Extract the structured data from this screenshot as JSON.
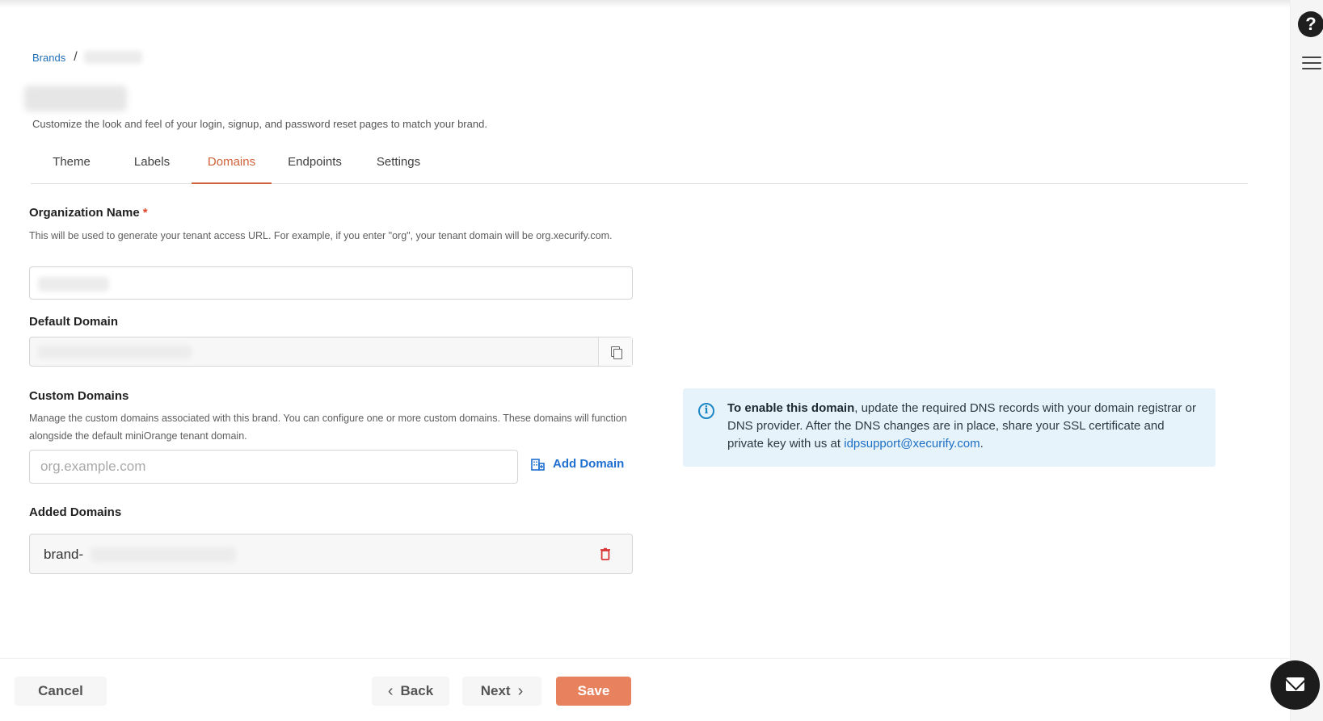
{
  "breadcrumb": {
    "root": "Brands",
    "separator": "/"
  },
  "page": {
    "subtitle": "Customize the look and feel of your login, signup, and password reset pages to match your brand."
  },
  "tabs": [
    {
      "label": "Theme"
    },
    {
      "label": "Labels"
    },
    {
      "label": "Domains",
      "active": true
    },
    {
      "label": "Endpoints"
    },
    {
      "label": "Settings"
    }
  ],
  "org_name": {
    "label": "Organization Name",
    "required_mark": "*",
    "help": "This will be used to generate your tenant access URL. For example, if you enter \"org\", your tenant domain will be org.xecurify.com."
  },
  "default_domain": {
    "label": "Default Domain",
    "copy_icon": "copy-icon"
  },
  "custom_domains": {
    "label": "Custom Domains",
    "help": "Manage the custom domains associated with this brand. You can configure one or more custom domains. These domains will function alongside the default miniOrange tenant domain.",
    "placeholder": "org.example.com",
    "add_label": "Add Domain",
    "add_icon": "domain-add-icon"
  },
  "added_domains": {
    "label": "Added Domains",
    "items": [
      {
        "prefix": "brand-",
        "delete_icon": "trash-icon"
      }
    ]
  },
  "info": {
    "bold": "To enable this domain",
    "text": ", update the required DNS records with your domain registrar or DNS provider. After the DNS changes are in place, share your SSL certificate and private key with us at ",
    "email": "idpsupport@xecurify.com",
    "end": ".",
    "icon": "info-icon"
  },
  "footer": {
    "cancel": "Cancel",
    "back": "Back",
    "next": "Next",
    "save": "Save"
  },
  "side": {
    "help_glyph": "?",
    "help_icon": "help-icon",
    "menu_icon": "hamburger-menu-icon",
    "chat_icon": "mail-icon"
  },
  "colors": {
    "accent": "#d0623a",
    "save": "#e8825e",
    "link": "#1f6fd0",
    "info_bg": "#e6f3fb",
    "danger": "#d93636"
  }
}
